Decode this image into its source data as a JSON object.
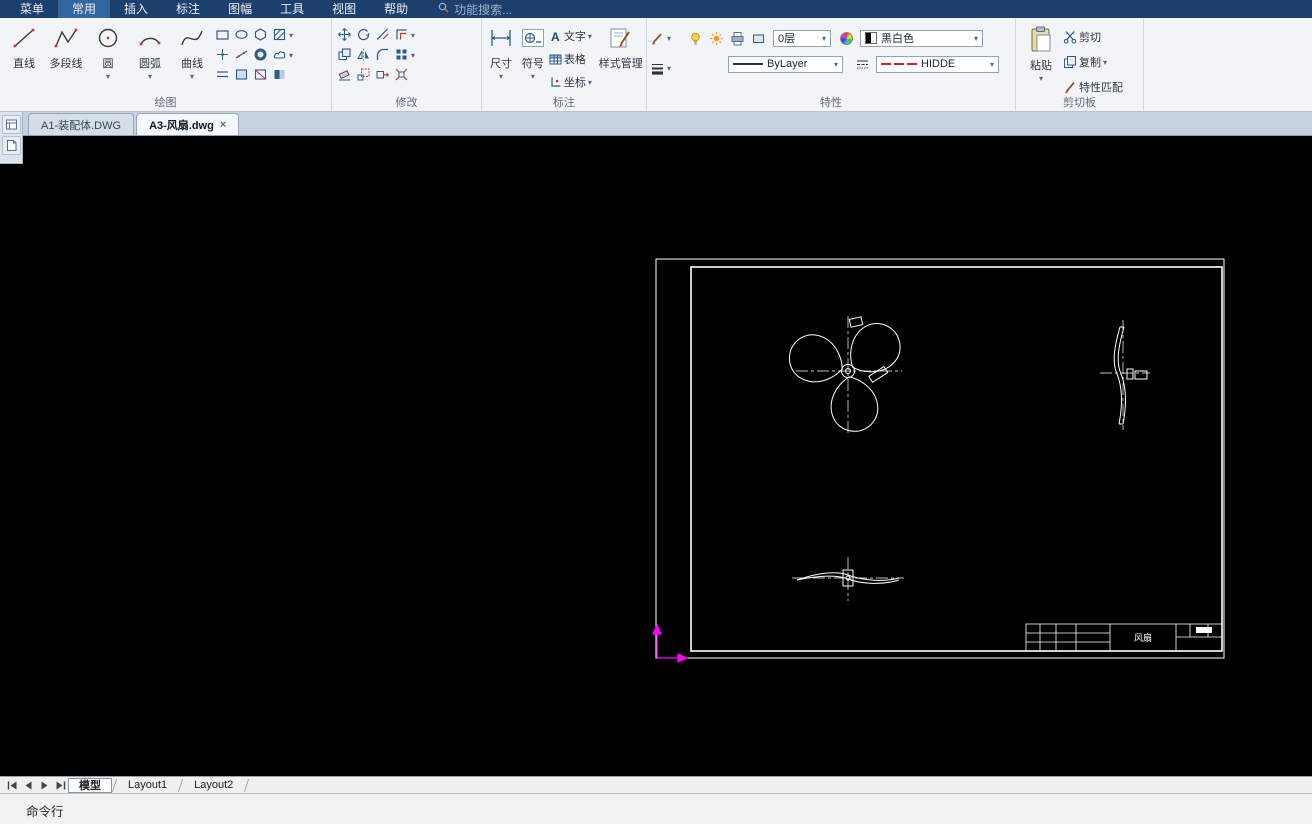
{
  "colors": {
    "menubar_bg": "#1d3f6e",
    "canvas_bg": "#000000",
    "drawing_line": "#ffffff",
    "ucs_axis": "#ff00ff",
    "hidden_linetype_red": "#cc2222"
  },
  "menubar": {
    "items": [
      {
        "label": "菜单"
      },
      {
        "label": "常用"
      },
      {
        "label": "插入"
      },
      {
        "label": "标注"
      },
      {
        "label": "图幅"
      },
      {
        "label": "工具"
      },
      {
        "label": "视图"
      },
      {
        "label": "帮助"
      }
    ],
    "active_item": "常用",
    "search_placeholder": "功能搜索..."
  },
  "ribbon": {
    "groups": {
      "draw": {
        "label": "绘图",
        "tools": [
          {
            "label": "直线"
          },
          {
            "label": "多段线"
          },
          {
            "label": "圆"
          },
          {
            "label": "圆弧"
          },
          {
            "label": "曲线"
          }
        ]
      },
      "modify": {
        "label": "修改"
      },
      "annotate": {
        "label": "标注",
        "dim_label": "尺寸",
        "symbol_label": "符号",
        "text_label": "文字",
        "table_label": "表格",
        "coord_label": "坐标",
        "style_label": "样式管理",
        "text_icon_glyph": "A"
      },
      "properties": {
        "label": "特性",
        "layer_value": "0层",
        "color_value": "黑白色",
        "linetype_value": "ByLayer",
        "linetype2_value": "HIDDE"
      },
      "clipboard": {
        "label": "剪切板",
        "paste_label": "粘贴",
        "cut_label": "剪切",
        "copy_label": "复制",
        "match_label": "特性匹配"
      }
    }
  },
  "doc_tabs": [
    {
      "label": "A1-装配体.DWG"
    },
    {
      "label": "A3-风扇.dwg"
    }
  ],
  "drawing": {
    "title_block_text": "风扇"
  },
  "layout_bar": {
    "tabs": [
      {
        "label": "模型"
      },
      {
        "label": "Layout1"
      },
      {
        "label": "Layout2"
      }
    ]
  },
  "command_bar": {
    "label": "命令行"
  }
}
